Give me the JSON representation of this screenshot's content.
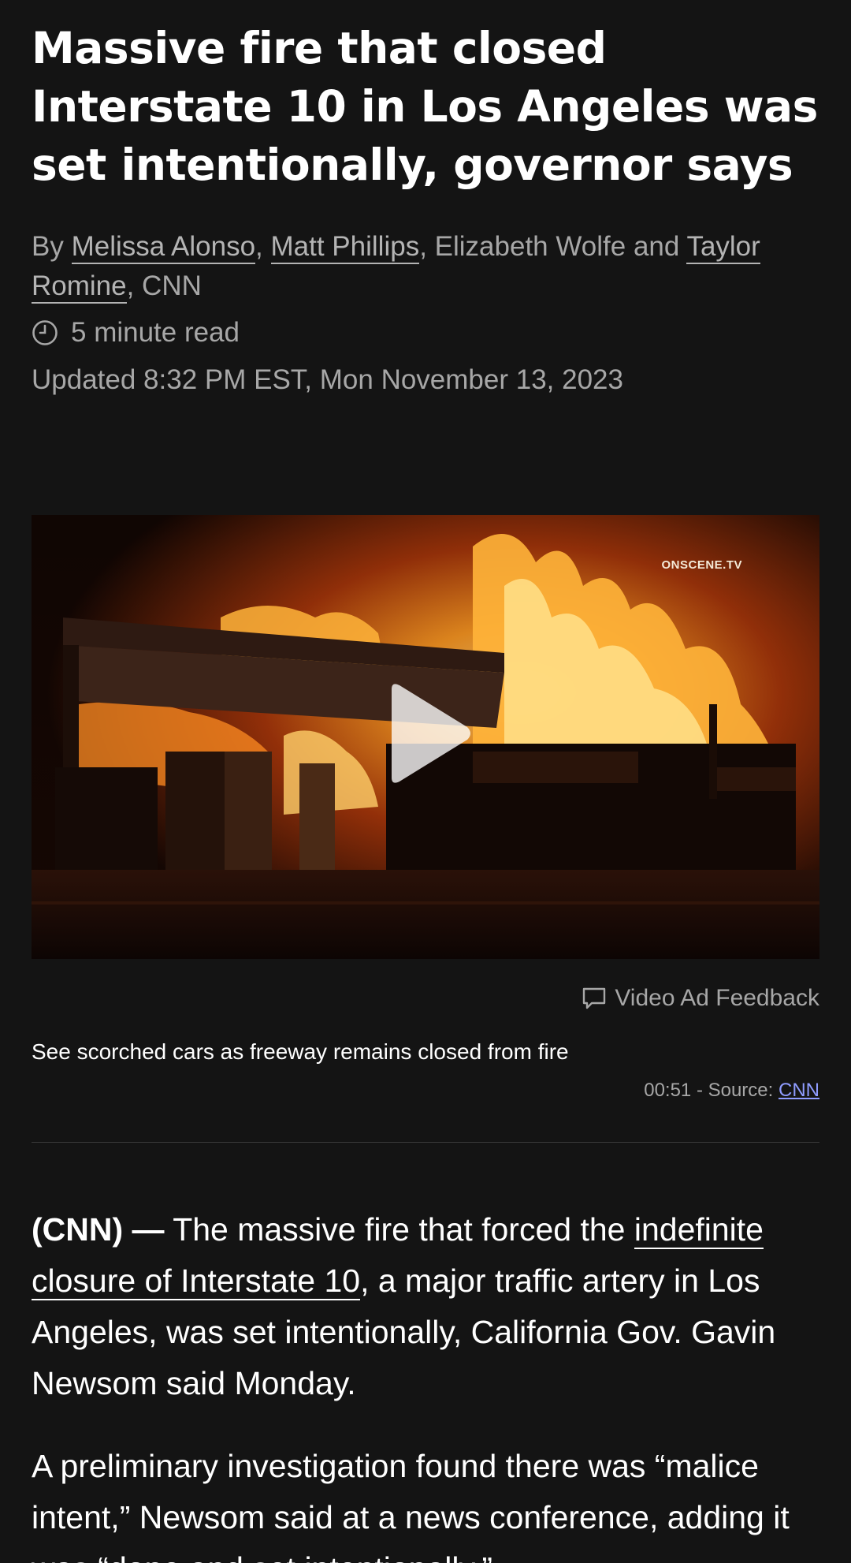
{
  "article": {
    "headline": "Massive fire that closed Interstate 10 in Los Angeles was set intentionally, governor says",
    "byline": {
      "prefix": "By",
      "authors": [
        "Melissa Alonso",
        "Matt Phillips",
        "Elizabeth Wolfe",
        "Taylor Romine"
      ],
      "sep1": ",",
      "sep2": ",",
      "and_text": "and",
      "suffix": ", CNN"
    },
    "read_time": "5 minute read",
    "updated": "Updated 8:32 PM EST, Mon November 13, 2023"
  },
  "video": {
    "watermark": "ONSCENE.TV",
    "feedback_label": "Video Ad Feedback",
    "caption": "See scorched cars as freeway remains closed from fire",
    "duration_source": "00:51 - Source:",
    "source_link": "CNN"
  },
  "body": {
    "p1_dateline": "(CNN) —",
    "p1_before_link": "The massive fire that forced the",
    "p1_link": "indefinite closure of Interstate 10",
    "p1_after_link": ", a major traffic artery in Los Angeles, was set intentionally, California Gov. Gavin Newsom said Monday.",
    "p2": "A preliminary investigation found there was “malice intent,” Newsom said at a news conference, adding it was “done and set intentionally.”"
  },
  "icons": {
    "clock": "clock-icon",
    "feedback": "chat-bubble-icon",
    "play": "play-icon"
  },
  "colors": {
    "background": "#141414",
    "headline": "#ffffff",
    "meta_text": "#a7a7a7",
    "source_link": "#8f9cff"
  }
}
